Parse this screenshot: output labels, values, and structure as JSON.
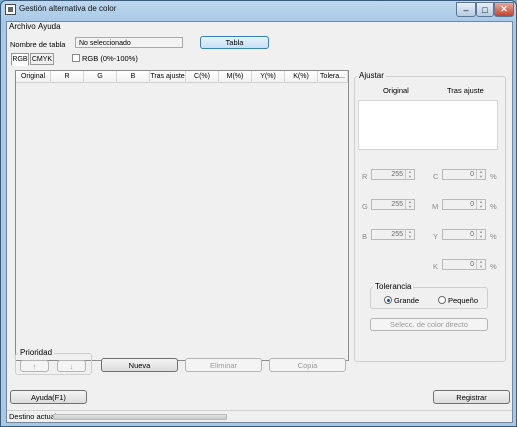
{
  "window": {
    "title": "Gestión alternativa de color",
    "minimize": "–",
    "maximize": "□",
    "close": "✕"
  },
  "menu": [
    "Archivo",
    "Ayuda"
  ],
  "table_name": {
    "label": "Nombre de tabla",
    "value": "No seleccionado",
    "button": "Tabla"
  },
  "tabs": [
    "RGB",
    "CMYK"
  ],
  "rgb_percent_label": "RGB (0%-100%)",
  "columns": [
    "Original",
    "R",
    "G",
    "B",
    "Tras ajuste",
    "C(%)",
    "M(%)",
    "Y(%)",
    "K(%)",
    "Tolera..."
  ],
  "adjust": {
    "title": "Ajustar",
    "original": "Original",
    "after": "Tras ajuste",
    "r_label": "R",
    "r_value": "255",
    "g_label": "G",
    "g_value": "255",
    "b_label": "B",
    "b_value": "255",
    "c_label": "C",
    "c_value": "0",
    "m_label": "M",
    "m_value": "0",
    "y_label": "Y",
    "y_value": "0",
    "k_label": "K",
    "k_value": "0",
    "percent": "%",
    "tolerance": {
      "title": "Tolerancia",
      "large": "Grande",
      "small": "Pequeño"
    },
    "direct_button": "Selecc. de color directo"
  },
  "priority": {
    "title": "Prioridad",
    "up": "↑",
    "down": "↓"
  },
  "buttons": {
    "new": "Nueva",
    "delete": "Eliminar",
    "copy": "Copia",
    "help": "Ayuda(F1)",
    "register": "Registrar"
  },
  "status": {
    "label": "Destino actual"
  }
}
